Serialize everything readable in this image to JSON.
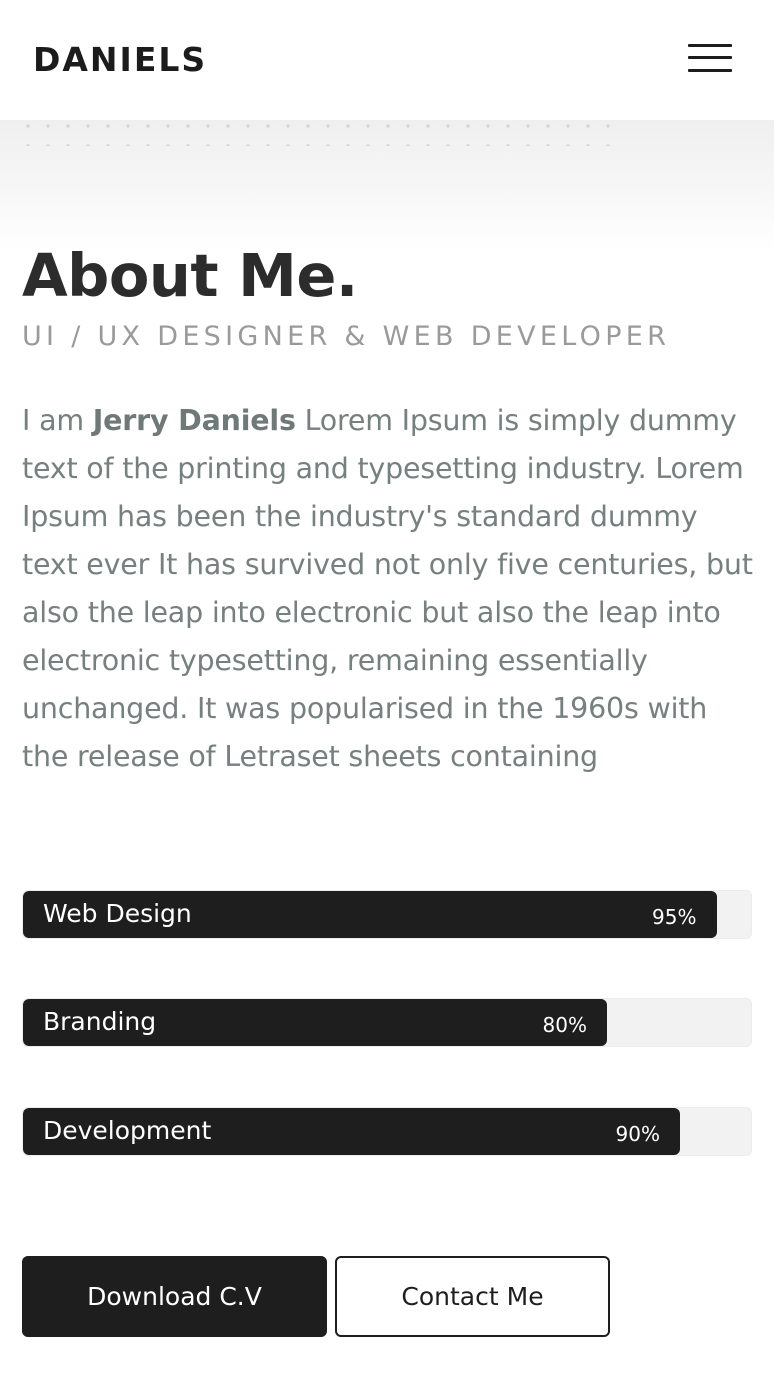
{
  "header": {
    "logo": "DANIELS",
    "menu_icon": "hamburger-menu-icon"
  },
  "about": {
    "title": "About Me.",
    "subtitle": "UI / UX DESIGNER & WEB DEVELOPER",
    "bio_prefix": "I am ",
    "bio_name": "Jerry Daniels",
    "bio_text": " Lorem Ipsum is simply dummy text of the printing and typesetting industry. Lorem Ipsum has been the industry's standard dummy text ever It has survived not only five centuries, but also the leap into electronic but also the leap into electronic typesetting, remaining essentially unchanged. It was popularised in the 1960s with the release of Letraset sheets containing"
  },
  "skills": [
    {
      "label": "Web Design",
      "percent_text": "95%",
      "value": 95
    },
    {
      "label": "Branding",
      "percent_text": "80%",
      "value": 80
    },
    {
      "label": "Development",
      "percent_text": "90%",
      "value": 90
    }
  ],
  "buttons": {
    "download": "Download C.V",
    "contact": "Contact Me"
  },
  "colors": {
    "dark": "#1e1e1e",
    "text_gray": "#75807f",
    "subtitle_gray": "#9a9a9a"
  }
}
